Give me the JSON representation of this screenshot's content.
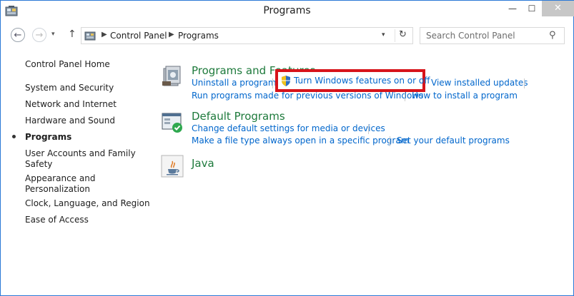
{
  "window": {
    "title": "Programs",
    "minimize_glyph": "—",
    "maximize_glyph": "☐",
    "close_glyph": "✕"
  },
  "nav": {
    "back_glyph": "←",
    "forward_glyph": "→",
    "recent_glyph": "▾",
    "up_glyph": "↑",
    "breadcrumb": [
      "Control Panel",
      "Programs"
    ],
    "dropdown_glyph": "▾",
    "refresh_glyph": "↻",
    "search_placeholder": "Search Control Panel"
  },
  "sidebar": {
    "items": [
      {
        "label": "Control Panel Home"
      },
      {
        "label": "System and Security"
      },
      {
        "label": "Network and Internet"
      },
      {
        "label": "Hardware and Sound"
      },
      {
        "label": "Programs",
        "current": true
      },
      {
        "label": "User Accounts and Family",
        "label2": "Safety"
      },
      {
        "label": "Appearance and",
        "label2": "Personalization"
      },
      {
        "label": "Clock, Language, and Region"
      },
      {
        "label": "Ease of Access"
      }
    ]
  },
  "categories": {
    "programs_features": {
      "title": "Programs and Features",
      "links": [
        "Uninstall a program",
        "Turn Windows features on or off",
        "View installed updates",
        "Run programs made for previous versions of Windows",
        "How to install a program"
      ]
    },
    "default_programs": {
      "title": "Default Programs",
      "links": [
        "Change default settings for media or devices",
        "Make a file type always open in a specific program",
        "Set your default programs"
      ]
    },
    "java": {
      "title": "Java"
    }
  },
  "icons": {
    "app": "control-panel-icon",
    "programs_features": "programs-features-icon",
    "default_programs": "default-programs-icon",
    "java": "java-icon",
    "shield": "uac-shield-icon"
  },
  "colors": {
    "link": "#0066cc",
    "category_title": "#1e7a3c",
    "highlight_border": "#d7141b",
    "close_button": "#c7c7c7"
  }
}
